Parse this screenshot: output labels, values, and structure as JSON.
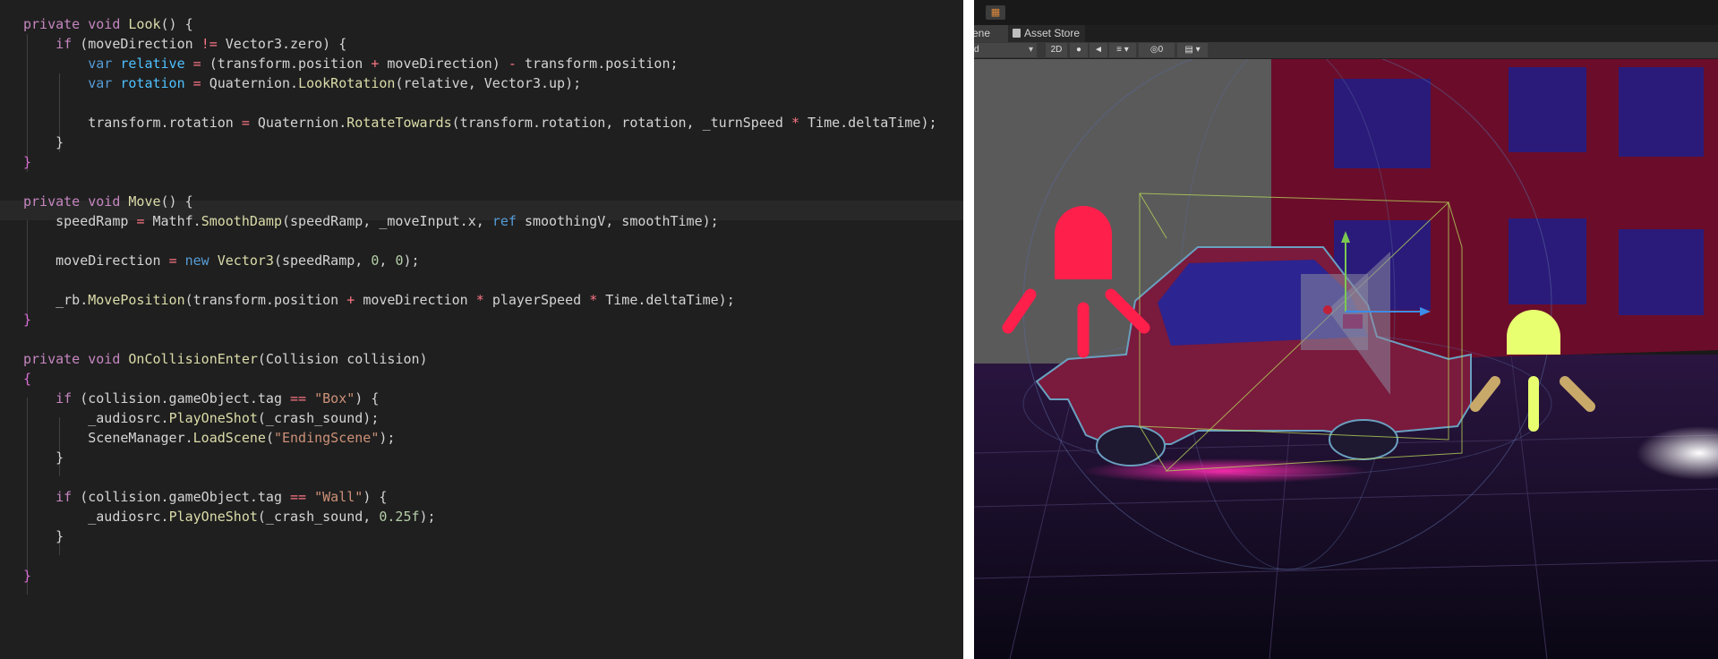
{
  "editor": {
    "lines": [
      [
        {
          "c": "k",
          "t": "private "
        },
        {
          "c": "k",
          "t": "void "
        },
        {
          "c": "fn",
          "t": "Look"
        },
        {
          "c": "m",
          "t": "() {"
        }
      ],
      [
        {
          "c": "m",
          "t": "    "
        },
        {
          "c": "k",
          "t": "if "
        },
        {
          "c": "m",
          "t": "(moveDirection "
        },
        {
          "c": "op",
          "t": "!= "
        },
        {
          "c": "m",
          "t": "Vector3.zero) {"
        }
      ],
      [
        {
          "c": "m",
          "t": "        "
        },
        {
          "c": "kb",
          "t": "var "
        },
        {
          "c": "mt",
          "t": "relative "
        },
        {
          "c": "op",
          "t": "= "
        },
        {
          "c": "m",
          "t": "(transform.position "
        },
        {
          "c": "op",
          "t": "+ "
        },
        {
          "c": "m",
          "t": "moveDirection) "
        },
        {
          "c": "op",
          "t": "- "
        },
        {
          "c": "m",
          "t": "transform.position;"
        }
      ],
      [
        {
          "c": "m",
          "t": "        "
        },
        {
          "c": "kb",
          "t": "var "
        },
        {
          "c": "mt",
          "t": "rotation "
        },
        {
          "c": "op",
          "t": "= "
        },
        {
          "c": "m",
          "t": "Quaternion."
        },
        {
          "c": "fn",
          "t": "LookRotation"
        },
        {
          "c": "m",
          "t": "(relative, Vector3.up);"
        }
      ],
      [],
      [
        {
          "c": "m",
          "t": "        transform.rotation "
        },
        {
          "c": "op",
          "t": "= "
        },
        {
          "c": "m",
          "t": "Quaternion."
        },
        {
          "c": "fn",
          "t": "RotateTowards"
        },
        {
          "c": "m",
          "t": "(transform.rotation, rotation, _turnSpeed "
        },
        {
          "c": "op",
          "t": "* "
        },
        {
          "c": "m",
          "t": "Time.deltaTime);"
        }
      ],
      [
        {
          "c": "m",
          "t": "    }"
        }
      ],
      [
        {
          "c": "br",
          "t": "}"
        }
      ],
      [],
      [
        {
          "c": "k",
          "t": "private "
        },
        {
          "c": "k",
          "t": "void "
        },
        {
          "c": "fn",
          "t": "Move"
        },
        {
          "c": "m",
          "t": "() {"
        }
      ],
      [
        {
          "c": "m",
          "t": "    speedRamp "
        },
        {
          "c": "op",
          "t": "= "
        },
        {
          "c": "m",
          "t": "Mathf."
        },
        {
          "c": "fn",
          "t": "SmoothDamp"
        },
        {
          "c": "m",
          "t": "(speedRamp, _moveInput.x, "
        },
        {
          "c": "kb",
          "t": "ref "
        },
        {
          "c": "m",
          "t": "smoothingV, smoothTime);"
        }
      ],
      [],
      [
        {
          "c": "m",
          "t": "    moveDirection "
        },
        {
          "c": "op",
          "t": "= "
        },
        {
          "c": "kb",
          "t": "new "
        },
        {
          "c": "fn",
          "t": "Vector3"
        },
        {
          "c": "m",
          "t": "(speedRamp, "
        },
        {
          "c": "n",
          "t": "0"
        },
        {
          "c": "m",
          "t": ", "
        },
        {
          "c": "n",
          "t": "0"
        },
        {
          "c": "m",
          "t": ");"
        }
      ],
      [],
      [
        {
          "c": "m",
          "t": "    _rb."
        },
        {
          "c": "fn",
          "t": "MovePosition"
        },
        {
          "c": "m",
          "t": "(transform.position "
        },
        {
          "c": "op",
          "t": "+ "
        },
        {
          "c": "m",
          "t": "moveDirection "
        },
        {
          "c": "op",
          "t": "* "
        },
        {
          "c": "m",
          "t": "playerSpeed "
        },
        {
          "c": "op",
          "t": "* "
        },
        {
          "c": "m",
          "t": "Time.deltaTime);"
        }
      ],
      [
        {
          "c": "br",
          "t": "}"
        }
      ],
      [],
      [
        {
          "c": "k",
          "t": "private "
        },
        {
          "c": "k",
          "t": "void "
        },
        {
          "c": "fn",
          "t": "OnCollisionEnter"
        },
        {
          "c": "m",
          "t": "(Collision collision)"
        }
      ],
      [
        {
          "c": "br",
          "t": "{"
        }
      ],
      [
        {
          "c": "m",
          "t": "    "
        },
        {
          "c": "k",
          "t": "if "
        },
        {
          "c": "m",
          "t": "(collision.gameObject.tag "
        },
        {
          "c": "op",
          "t": "== "
        },
        {
          "c": "s",
          "t": "\"Box\""
        },
        {
          "c": "m",
          "t": ") {"
        }
      ],
      [
        {
          "c": "m",
          "t": "        _audiosrc."
        },
        {
          "c": "fn",
          "t": "PlayOneShot"
        },
        {
          "c": "m",
          "t": "(_crash_sound);"
        }
      ],
      [
        {
          "c": "m",
          "t": "        SceneManager."
        },
        {
          "c": "fn",
          "t": "LoadScene"
        },
        {
          "c": "m",
          "t": "("
        },
        {
          "c": "s",
          "t": "\"EndingScene\""
        },
        {
          "c": "m",
          "t": ");"
        }
      ],
      [
        {
          "c": "m",
          "t": "    }"
        }
      ],
      [],
      [
        {
          "c": "m",
          "t": "    "
        },
        {
          "c": "k",
          "t": "if "
        },
        {
          "c": "m",
          "t": "(collision.gameObject.tag "
        },
        {
          "c": "op",
          "t": "== "
        },
        {
          "c": "s",
          "t": "\"Wall\""
        },
        {
          "c": "m",
          "t": ") {"
        }
      ],
      [
        {
          "c": "m",
          "t": "        _audiosrc."
        },
        {
          "c": "fn",
          "t": "PlayOneShot"
        },
        {
          "c": "m",
          "t": "(_crash_sound, "
        },
        {
          "c": "n",
          "t": "0.25f"
        },
        {
          "c": "m",
          "t": ");"
        }
      ],
      [
        {
          "c": "m",
          "t": "    }"
        }
      ],
      [],
      [
        {
          "c": "br",
          "t": "}"
        }
      ]
    ]
  },
  "unity": {
    "tabs": {
      "scene": "ene",
      "asset_store": "Asset Store"
    },
    "toolbar": {
      "shading": "d",
      "mode_2d": "2D",
      "lighting": "●",
      "audio": "◄",
      "effects": "≡ ▾",
      "hidden_count": "◎0",
      "gizmos": "▤ ▾"
    },
    "colors": {
      "building": "#6b0d2a",
      "windows": "#2a1b7a",
      "wall": "#5a5a5a",
      "car_body": "#7a1a3c",
      "car_glass": "#2c2490",
      "light_red": "#ff1f4b",
      "light_yellow": "#e8ff70",
      "pink_glow": "#ff2bb0"
    }
  }
}
